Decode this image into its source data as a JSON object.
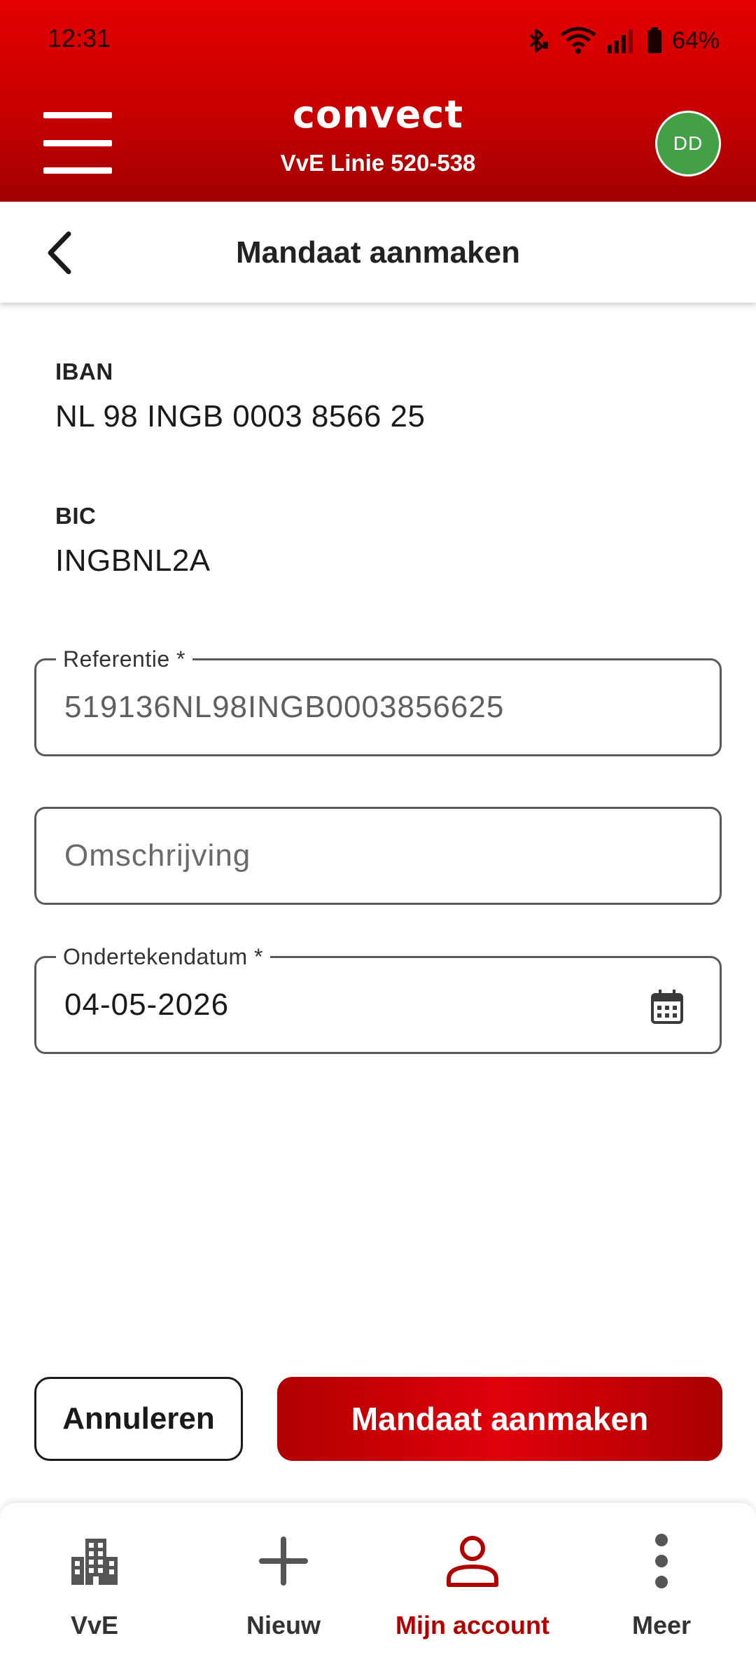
{
  "status_bar": {
    "time": "12:31",
    "battery": "64%",
    "icons": [
      "bluetooth-icon",
      "wifi-icon",
      "signal-icon",
      "battery-icon"
    ]
  },
  "header": {
    "logo": "convect",
    "subtitle": "VvE Linie 520-538",
    "avatar_initials": "DD",
    "avatar_color": "#43a047",
    "brand_color": "#d50000"
  },
  "title_bar": {
    "title": "Mandaat aanmaken"
  },
  "details": {
    "iban_label": "IBAN",
    "iban_value": "NL 98 INGB 0003 8566 25",
    "bic_label": "BIC",
    "bic_value": "INGBNL2A"
  },
  "form": {
    "referentie": {
      "label": "Referentie *",
      "value": "519136NL98INGB0003856625"
    },
    "omschrijving": {
      "placeholder": "Omschrijving"
    },
    "ondertekendatum": {
      "label": "Ondertekendatum *",
      "value": "04-05-2026"
    }
  },
  "actions": {
    "cancel_label": "Annuleren",
    "submit_label": "Mandaat aanmaken"
  },
  "bottom_nav": {
    "items": [
      {
        "label": "VvE",
        "icon": "building-icon",
        "active": false
      },
      {
        "label": "Nieuw",
        "icon": "plus-icon",
        "active": false
      },
      {
        "label": "Mijn account",
        "icon": "person-icon",
        "active": true
      },
      {
        "label": "Meer",
        "icon": "more-vertical-icon",
        "active": false
      }
    ],
    "active_color": "#b10000"
  }
}
